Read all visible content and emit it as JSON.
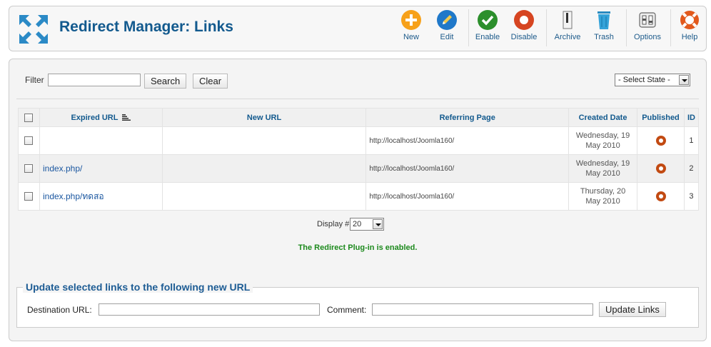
{
  "header": {
    "title": "Redirect Manager: Links",
    "toolbar": [
      {
        "label": "New",
        "icon": "new-icon",
        "color": "#f7a11a"
      },
      {
        "label": "Edit",
        "icon": "edit-icon",
        "color": "#1f78c9"
      },
      {
        "label": "Enable",
        "icon": "enable-icon",
        "color": "#2c8f2c"
      },
      {
        "label": "Disable",
        "icon": "disable-icon",
        "color": "#d64521"
      },
      {
        "label": "Archive",
        "icon": "archive-icon"
      },
      {
        "label": "Trash",
        "icon": "trash-icon",
        "color": "#34a3d9"
      },
      {
        "label": "Options",
        "icon": "options-icon"
      },
      {
        "label": "Help",
        "icon": "help-icon",
        "color": "#e2591c"
      }
    ]
  },
  "filter": {
    "label": "Filter",
    "value": "",
    "search_label": "Search",
    "clear_label": "Clear",
    "state_select": "- Select State -"
  },
  "table": {
    "columns": [
      "Expired URL",
      "New URL",
      "Referring Page",
      "Created Date",
      "Published",
      "ID"
    ],
    "rows": [
      {
        "expired_url": "",
        "new_url": "",
        "referring_page": "http://localhost/Joomla160/",
        "date_line1": "Wednesday, 19",
        "date_line2": "May 2010",
        "published": true,
        "id": "1"
      },
      {
        "expired_url": "index.php/",
        "new_url": "",
        "referring_page": "http://localhost/Joomla160/",
        "date_line1": "Wednesday, 19",
        "date_line2": "May 2010",
        "published": true,
        "id": "2"
      },
      {
        "expired_url": "index.php/ทดสอ",
        "new_url": "",
        "referring_page": "http://localhost/Joomla160/",
        "date_line1": "Thursday, 20",
        "date_line2": "May 2010",
        "published": true,
        "id": "3"
      }
    ]
  },
  "pagination": {
    "display_label": "Display #",
    "display_value": "20"
  },
  "status": {
    "plugin_message": "The Redirect Plug-in is enabled.",
    "color": "#1d8a1d"
  },
  "update": {
    "legend": "Update selected links to the following new URL",
    "destination_label": "Destination URL:",
    "destination_value": "",
    "comment_label": "Comment:",
    "comment_value": "",
    "button_label": "Update Links"
  }
}
